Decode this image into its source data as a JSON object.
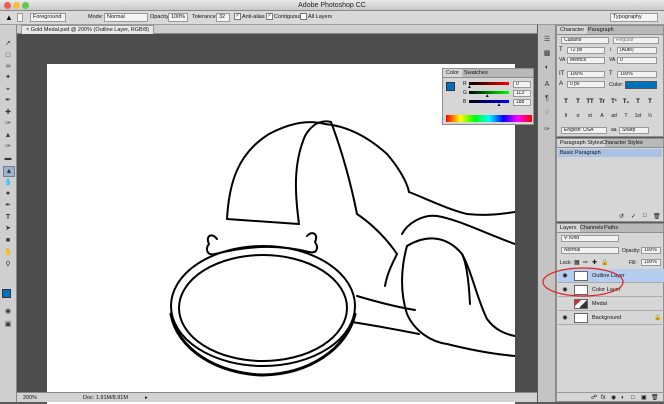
{
  "app": {
    "title": "Adobe Photoshop CC"
  },
  "options_bar": {
    "tool_preset": "Foreground",
    "mode_label": "Mode:",
    "mode_value": "Normal",
    "opacity_label": "Opacity:",
    "opacity_value": "100%",
    "tolerance_label": "Tolerance:",
    "tolerance_value": "32",
    "anti_alias": "Anti-alias",
    "contiguous": "Contiguous",
    "all_layers": "All Layers",
    "workspace": "Typography"
  },
  "document": {
    "tab_label": "Gold Medal.psd @ 200% (Outline Layer, RGB/8)",
    "tab_close": "×",
    "zoom": "200%",
    "doc_info": "Doc: 1.91M/8.91M"
  },
  "color_panel": {
    "tabs": [
      "Color",
      "Swatches"
    ],
    "sliders": [
      {
        "label": "R",
        "value": "0",
        "fraction": 0.0
      },
      {
        "label": "G",
        "value": "113",
        "fraction": 0.443
      },
      {
        "label": "B",
        "value": "188",
        "fraction": 0.737
      }
    ],
    "foreground_color": "#0071bc"
  },
  "character_panel": {
    "tabs": [
      "Character",
      "Paragraph"
    ],
    "font_family": "Cubano",
    "font_style": "Regular",
    "size": "72 px",
    "leading": "(Auto)",
    "kerning": "Metrics",
    "tracking": "0",
    "vertical_scale": "100%",
    "horizontal_scale": "100%",
    "baseline_shift": "0 px",
    "color_label": "Color:",
    "color": "#0071bc",
    "type_styles": [
      "T",
      "T",
      "TT",
      "Tr",
      "T¹",
      "T₁",
      "T",
      "T"
    ],
    "opentype": [
      "fi",
      "σ",
      "st",
      "A",
      "ad",
      "T",
      "1st",
      "½"
    ],
    "language": "English: USA",
    "antialias": "Sharp",
    "aa_icon": "aa"
  },
  "paragraph_styles_panel": {
    "tabs": [
      "Paragraph Styles",
      "Character Styles"
    ],
    "items": [
      "Basic Paragraph"
    ]
  },
  "layers_panel": {
    "tabs": [
      "Layers",
      "Channels",
      "Paths"
    ],
    "filter": "Kind",
    "blend_mode": "Normal",
    "opacity_label": "Opacity:",
    "opacity_value": "100%",
    "lock_label": "Lock:",
    "fill_label": "Fill:",
    "fill_value": "100%",
    "layers": [
      {
        "name": "Outline Layer",
        "visible": true,
        "selected": true
      },
      {
        "name": "Color Layer",
        "visible": true,
        "selected": false
      },
      {
        "name": "Medal",
        "visible": false,
        "selected": false
      },
      {
        "name": "Background",
        "visible": true,
        "selected": false,
        "locked": true
      }
    ],
    "annotation_color": "#e02020"
  }
}
